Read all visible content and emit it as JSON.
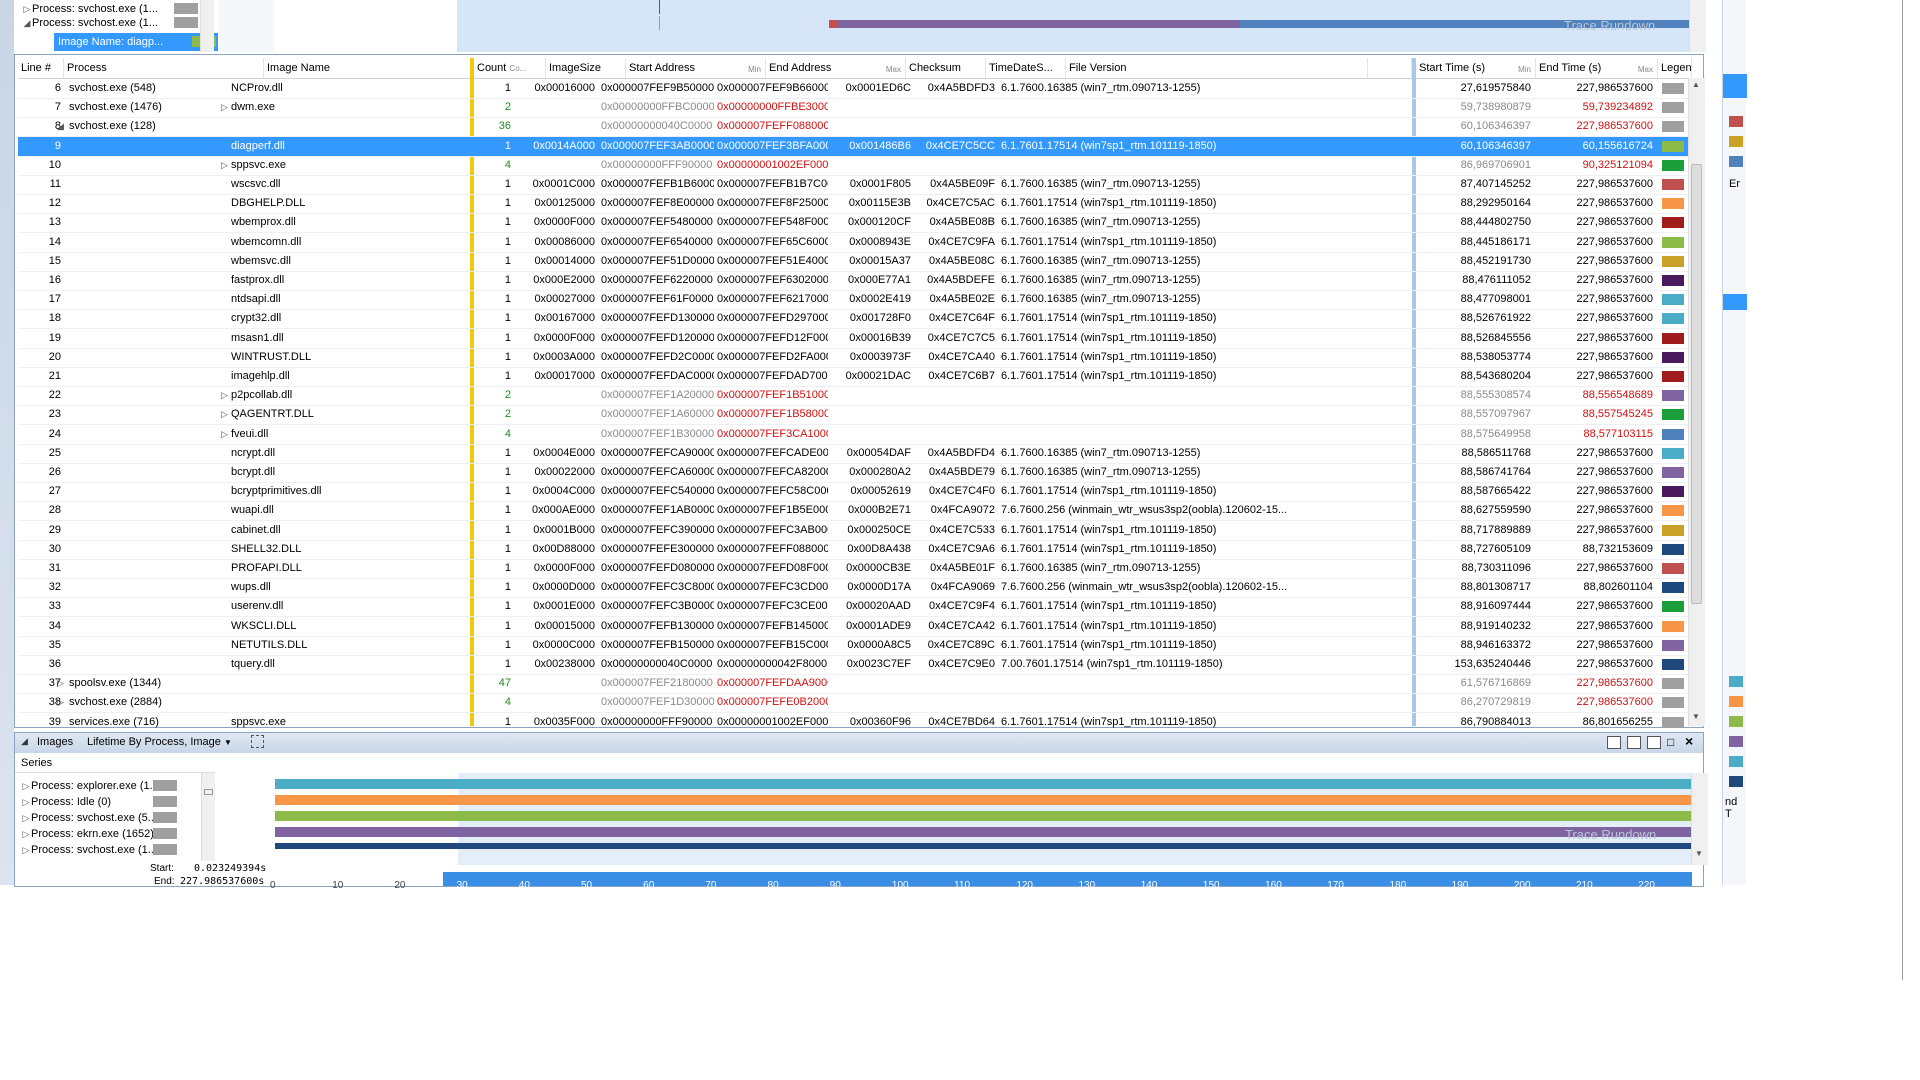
{
  "top_series": [
    {
      "label": "Process: svchost.exe (1...",
      "expanded": false,
      "color": "#a0a0a0"
    },
    {
      "label": "Process: svchost.exe (1...",
      "expanded": true,
      "color": "#a0a0a0"
    },
    {
      "label": "Image Name: diagp...",
      "selected": true,
      "color": "#8dbb4a"
    }
  ],
  "columns": {
    "line": "Line #",
    "process": "Process",
    "image_name": "Image Name",
    "count": "Count",
    "count_sub": "Co...",
    "image_size": "ImageSize",
    "start_address": "Start Address",
    "start_sub": "Min",
    "end_address": "End Address",
    "end_sub": "Max",
    "checksum": "Checksum",
    "timedate": "TimeDateS...",
    "file_version": "File Version",
    "start_time": "Start Time (s)",
    "start_time_sub": "Min",
    "end_time": "End Time (s)",
    "end_time_sub": "Max",
    "legend": "Legend"
  },
  "rows": [
    {
      "line": "6",
      "proc": "svchost.exe (548)",
      "proc_tri": "",
      "img": "NCProv.dll",
      "img_tri": "",
      "count": "1",
      "cc": "",
      "size": "0x00016000",
      "sa": "0x000007FEF9B50000",
      "ea": "0x000007FEF9B66000",
      "ec": "",
      "cs": "0x0001ED6C",
      "td": "0x4A5BDFD3",
      "fv": "6.1.7600.16385 (win7_rtm.090713-1255)",
      "st": "27,619575840",
      "stc": "",
      "et": "227,986537600",
      "etc": "",
      "lg": "#a0a0a0"
    },
    {
      "line": "7",
      "proc": "svchost.exe (1476)",
      "proc_tri": "",
      "img": "dwm.exe",
      "img_tri": "▷",
      "count": "2",
      "cc": "green",
      "size": "",
      "sa": "0x00000000FFBC0000",
      "ea": "0x00000000FFBE3000",
      "ec": "red",
      "cs": "",
      "td": "",
      "fv": "",
      "st": "59,738980879",
      "stc": "gray",
      "et": "59,739234892",
      "etc": "red",
      "lg": "#a0a0a0"
    },
    {
      "line": "8",
      "proc": "svchost.exe (128)",
      "proc_tri": "◢",
      "img": "",
      "img_tri": "",
      "count": "36",
      "cc": "green",
      "size": "",
      "sa": "0x00000000040C0000",
      "ea": "0x000007FEFF088000",
      "ec": "red",
      "cs": "",
      "td": "",
      "fv": "",
      "st": "60,106346397",
      "stc": "gray",
      "et": "227,986537600",
      "etc": "red",
      "lg": "#a0a0a0"
    },
    {
      "line": "9",
      "proc": "",
      "proc_tri": "",
      "img": "diagperf.dll",
      "img_tri": "",
      "count": "1",
      "cc": "",
      "size": "0x0014A000",
      "sa": "0x000007FEF3AB0000",
      "ea": "0x000007FEF3BFA000",
      "ec": "",
      "cs": "0x001486B6",
      "td": "0x4CE7C5CC",
      "fv": "6.1.7601.17514 (win7sp1_rtm.101119-1850)",
      "st": "60,106346397",
      "stc": "",
      "et": "60,155616724",
      "etc": "",
      "lg": "#8dbb4a",
      "sel": true
    },
    {
      "line": "10",
      "proc": "",
      "proc_tri": "",
      "img": "sppsvc.exe",
      "img_tri": "▷",
      "count": "4",
      "cc": "green",
      "size": "",
      "sa": "0x00000000FFF90000",
      "ea": "0x00000001002EF000",
      "ec": "red",
      "cs": "",
      "td": "",
      "fv": "",
      "st": "86,969706901",
      "stc": "gray",
      "et": "90,325121094",
      "etc": "red",
      "lg": "#1a9e3a"
    },
    {
      "line": "11",
      "proc": "",
      "proc_tri": "",
      "img": "wscsvc.dll",
      "img_tri": "",
      "count": "1",
      "cc": "",
      "size": "0x0001C000",
      "sa": "0x000007FEFB1B60000",
      "ea": "0x000007FEFB1B7C000",
      "ec": "",
      "cs": "0x0001F805",
      "td": "0x4A5BE09F",
      "fv": "6.1.7600.16385 (win7_rtm.090713-1255)",
      "st": "87,407145252",
      "stc": "",
      "et": "227,986537600",
      "etc": "",
      "lg": "#c0504d"
    },
    {
      "line": "12",
      "proc": "",
      "proc_tri": "",
      "img": "DBGHELP.DLL",
      "img_tri": "",
      "count": "1",
      "cc": "",
      "size": "0x00125000",
      "sa": "0x000007FEF8E00000",
      "ea": "0x000007FEF8F25000",
      "ec": "",
      "cs": "0x00115E3B",
      "td": "0x4CE7C5AC",
      "fv": "6.1.7601.17514 (win7sp1_rtm.101119-1850)",
      "st": "88,292950164",
      "stc": "",
      "et": "227,986537600",
      "etc": "",
      "lg": "#f79646"
    },
    {
      "line": "13",
      "proc": "",
      "proc_tri": "",
      "img": "wbemprox.dll",
      "img_tri": "",
      "count": "1",
      "cc": "",
      "size": "0x0000F000",
      "sa": "0x000007FEF5480000",
      "ea": "0x000007FEF548F000",
      "ec": "",
      "cs": "0x000120CF",
      "td": "0x4A5BE08B",
      "fv": "6.1.7600.16385 (win7_rtm.090713-1255)",
      "st": "88,444802750",
      "stc": "",
      "et": "227,986537600",
      "etc": "",
      "lg": "#a01c1c"
    },
    {
      "line": "14",
      "proc": "",
      "proc_tri": "",
      "img": "wbemcomn.dll",
      "img_tri": "",
      "count": "1",
      "cc": "",
      "size": "0x00086000",
      "sa": "0x000007FEF6540000",
      "ea": "0x000007FEF65C6000",
      "ec": "",
      "cs": "0x0008943E",
      "td": "0x4CE7C9FA",
      "fv": "6.1.7601.17514 (win7sp1_rtm.101119-1850)",
      "st": "88,445186171",
      "stc": "",
      "et": "227,986537600",
      "etc": "",
      "lg": "#8dbb4a"
    },
    {
      "line": "15",
      "proc": "",
      "proc_tri": "",
      "img": "wbemsvc.dll",
      "img_tri": "",
      "count": "1",
      "cc": "",
      "size": "0x00014000",
      "sa": "0x000007FEF51D0000",
      "ea": "0x000007FEF51E4000",
      "ec": "",
      "cs": "0x00015A37",
      "td": "0x4A5BE08C",
      "fv": "6.1.7600.16385 (win7_rtm.090713-1255)",
      "st": "88,452191730",
      "stc": "",
      "et": "227,986537600",
      "etc": "",
      "lg": "#c9a227"
    },
    {
      "line": "16",
      "proc": "",
      "proc_tri": "",
      "img": "fastprox.dll",
      "img_tri": "",
      "count": "1",
      "cc": "",
      "size": "0x000E2000",
      "sa": "0x000007FEF6220000",
      "ea": "0x000007FEF6302000",
      "ec": "",
      "cs": "0x000E77A1",
      "td": "0x4A5BDEFE",
      "fv": "6.1.7600.16385 (win7_rtm.090713-1255)",
      "st": "88,476111052",
      "stc": "",
      "et": "227,986537600",
      "etc": "",
      "lg": "#4b1a5e"
    },
    {
      "line": "17",
      "proc": "",
      "proc_tri": "",
      "img": "ntdsapi.dll",
      "img_tri": "",
      "count": "1",
      "cc": "",
      "size": "0x00027000",
      "sa": "0x000007FEF61F0000",
      "ea": "0x000007FEF6217000",
      "ec": "",
      "cs": "0x0002E419",
      "td": "0x4A5BE02E",
      "fv": "6.1.7600.16385 (win7_rtm.090713-1255)",
      "st": "88,477098001",
      "stc": "",
      "et": "227,986537600",
      "etc": "",
      "lg": "#4bacc6"
    },
    {
      "line": "18",
      "proc": "",
      "proc_tri": "",
      "img": "crypt32.dll",
      "img_tri": "",
      "count": "1",
      "cc": "",
      "size": "0x00167000",
      "sa": "0x000007FEFD130000",
      "ea": "0x000007FEFD297000",
      "ec": "",
      "cs": "0x001728F0",
      "td": "0x4CE7C64F",
      "fv": "6.1.7601.17514 (win7sp1_rtm.101119-1850)",
      "st": "88,526761922",
      "stc": "",
      "et": "227,986537600",
      "etc": "",
      "lg": "#4bacc6"
    },
    {
      "line": "19",
      "proc": "",
      "proc_tri": "",
      "img": "msasn1.dll",
      "img_tri": "",
      "count": "1",
      "cc": "",
      "size": "0x0000F000",
      "sa": "0x000007FEFD120000",
      "ea": "0x000007FEFD12F000",
      "ec": "",
      "cs": "0x00016B39",
      "td": "0x4CE7C7C5",
      "fv": "6.1.7601.17514 (win7sp1_rtm.101119-1850)",
      "st": "88,526845556",
      "stc": "",
      "et": "227,986537600",
      "etc": "",
      "lg": "#a01c1c"
    },
    {
      "line": "20",
      "proc": "",
      "proc_tri": "",
      "img": "WINTRUST.DLL",
      "img_tri": "",
      "count": "1",
      "cc": "",
      "size": "0x0003A000",
      "sa": "0x000007FEFD2C0000",
      "ea": "0x000007FEFD2FA000",
      "ec": "",
      "cs": "0x0003973F",
      "td": "0x4CE7CA40",
      "fv": "6.1.7601.17514 (win7sp1_rtm.101119-1850)",
      "st": "88,538053774",
      "stc": "",
      "et": "227,986537600",
      "etc": "",
      "lg": "#4b1a5e"
    },
    {
      "line": "21",
      "proc": "",
      "proc_tri": "",
      "img": "imagehlp.dll",
      "img_tri": "",
      "count": "1",
      "cc": "",
      "size": "0x00017000",
      "sa": "0x000007FEFDAC0000",
      "ea": "0x000007FEFDAD7000",
      "ec": "",
      "cs": "0x00021DAC",
      "td": "0x4CE7C6B7",
      "fv": "6.1.7601.17514 (win7sp1_rtm.101119-1850)",
      "st": "88,543680204",
      "stc": "",
      "et": "227,986537600",
      "etc": "",
      "lg": "#a01c1c"
    },
    {
      "line": "22",
      "proc": "",
      "proc_tri": "",
      "img": "p2pcollab.dll",
      "img_tri": "▷",
      "count": "2",
      "cc": "green",
      "size": "",
      "sa": "0x000007FEF1A20000",
      "ea": "0x000007FEF1B51000",
      "ec": "red",
      "cs": "",
      "td": "",
      "fv": "",
      "st": "88,555308574",
      "stc": "gray",
      "et": "88,556548689",
      "etc": "red",
      "lg": "#8064a2"
    },
    {
      "line": "23",
      "proc": "",
      "proc_tri": "",
      "img": "QAGENTRT.DLL",
      "img_tri": "▷",
      "count": "2",
      "cc": "green",
      "size": "",
      "sa": "0x000007FEF1A60000",
      "ea": "0x000007FEF1B58000",
      "ec": "red",
      "cs": "",
      "td": "",
      "fv": "",
      "st": "88,557097967",
      "stc": "gray",
      "et": "88,557545245",
      "etc": "red",
      "lg": "#1a9e3a"
    },
    {
      "line": "24",
      "proc": "",
      "proc_tri": "",
      "img": "fveui.dll",
      "img_tri": "▷",
      "count": "4",
      "cc": "green",
      "size": "",
      "sa": "0x000007FEF1B30000",
      "ea": "0x000007FEF3CA1000",
      "ec": "red",
      "cs": "",
      "td": "",
      "fv": "",
      "st": "88,575649958",
      "stc": "gray",
      "et": "88,577103115",
      "etc": "red",
      "lg": "#4f81bd"
    },
    {
      "line": "25",
      "proc": "",
      "proc_tri": "",
      "img": "ncrypt.dll",
      "img_tri": "",
      "count": "1",
      "cc": "",
      "size": "0x0004E000",
      "sa": "0x000007FEFCA90000",
      "ea": "0x000007FEFCADE000",
      "ec": "",
      "cs": "0x00054DAF",
      "td": "0x4A5BDFD4",
      "fv": "6.1.7600.16385 (win7_rtm.090713-1255)",
      "st": "88,586511768",
      "stc": "",
      "et": "227,986537600",
      "etc": "",
      "lg": "#4bacc6"
    },
    {
      "line": "26",
      "proc": "",
      "proc_tri": "",
      "img": "bcrypt.dll",
      "img_tri": "",
      "count": "1",
      "cc": "",
      "size": "0x00022000",
      "sa": "0x000007FEFCA60000",
      "ea": "0x000007FEFCA82000",
      "ec": "",
      "cs": "0x000280A2",
      "td": "0x4A5BDE79",
      "fv": "6.1.7600.16385 (win7_rtm.090713-1255)",
      "st": "88,586741764",
      "stc": "",
      "et": "227,986537600",
      "etc": "",
      "lg": "#8064a2"
    },
    {
      "line": "27",
      "proc": "",
      "proc_tri": "",
      "img": "bcryptprimitives.dll",
      "img_tri": "",
      "count": "1",
      "cc": "",
      "size": "0x0004C000",
      "sa": "0x000007FEFC540000",
      "ea": "0x000007FEFC58C000",
      "ec": "",
      "cs": "0x00052619",
      "td": "0x4CE7C4F0",
      "fv": "6.1.7601.17514 (win7sp1_rtm.101119-1850)",
      "st": "88,587665422",
      "stc": "",
      "et": "227,986537600",
      "etc": "",
      "lg": "#4b1a5e"
    },
    {
      "line": "28",
      "proc": "",
      "proc_tri": "",
      "img": "wuapi.dll",
      "img_tri": "",
      "count": "1",
      "cc": "",
      "size": "0x000AE000",
      "sa": "0x000007FEF1AB0000",
      "ea": "0x000007FEF1B5E000",
      "ec": "",
      "cs": "0x000B2E71",
      "td": "0x4FCA9072",
      "fv": "7.6.7600.256 (winmain_wtr_wsus3sp2(oobla).120602-15...",
      "st": "88,627559590",
      "stc": "",
      "et": "227,986537600",
      "etc": "",
      "lg": "#f79646"
    },
    {
      "line": "29",
      "proc": "",
      "proc_tri": "",
      "img": "cabinet.dll",
      "img_tri": "",
      "count": "1",
      "cc": "",
      "size": "0x0001B000",
      "sa": "0x000007FEFC390000",
      "ea": "0x000007FEFC3AB000",
      "ec": "",
      "cs": "0x000250CE",
      "td": "0x4CE7C533",
      "fv": "6.1.7601.17514 (win7sp1_rtm.101119-1850)",
      "st": "88,717889889",
      "stc": "",
      "et": "227,986537600",
      "etc": "",
      "lg": "#c9a227"
    },
    {
      "line": "30",
      "proc": "",
      "proc_tri": "",
      "img": "SHELL32.DLL",
      "img_tri": "",
      "count": "1",
      "cc": "",
      "size": "0x00D88000",
      "sa": "0x000007FEFE300000",
      "ea": "0x000007FEFF088000",
      "ec": "",
      "cs": "0x00D8A438",
      "td": "0x4CE7C9A6",
      "fv": "6.1.7601.17514 (win7sp1_rtm.101119-1850)",
      "st": "88,727605109",
      "stc": "",
      "et": "88,732153609",
      "etc": "",
      "lg": "#1f497d"
    },
    {
      "line": "31",
      "proc": "",
      "proc_tri": "",
      "img": "PROFAPI.DLL",
      "img_tri": "",
      "count": "1",
      "cc": "",
      "size": "0x0000F000",
      "sa": "0x000007FEFD080000",
      "ea": "0x000007FEFD08F000",
      "ec": "",
      "cs": "0x0000CB3E",
      "td": "0x4A5BE01F",
      "fv": "6.1.7600.16385 (win7_rtm.090713-1255)",
      "st": "88,730311096",
      "stc": "",
      "et": "227,986537600",
      "etc": "",
      "lg": "#c0504d"
    },
    {
      "line": "32",
      "proc": "",
      "proc_tri": "",
      "img": "wups.dll",
      "img_tri": "",
      "count": "1",
      "cc": "",
      "size": "0x0000D000",
      "sa": "0x000007FEFC3C8000",
      "ea": "0x000007FEFC3CD000",
      "ec": "",
      "cs": "0x0000D17A",
      "td": "0x4FCA9069",
      "fv": "7.6.7600.256 (winmain_wtr_wsus3sp2(oobla).120602-15...",
      "st": "88,801308717",
      "stc": "",
      "et": "88,802601104",
      "etc": "",
      "lg": "#1f497d"
    },
    {
      "line": "33",
      "proc": "",
      "proc_tri": "",
      "img": "userenv.dll",
      "img_tri": "",
      "count": "1",
      "cc": "",
      "size": "0x0001E000",
      "sa": "0x000007FEFC3B0000",
      "ea": "0x000007FEFC3CE000",
      "ec": "",
      "cs": "0x00020AAD",
      "td": "0x4CE7C9F4",
      "fv": "6.1.7601.17514 (win7sp1_rtm.101119-1850)",
      "st": "88,916097444",
      "stc": "",
      "et": "227,986537600",
      "etc": "",
      "lg": "#1a9e3a"
    },
    {
      "line": "34",
      "proc": "",
      "proc_tri": "",
      "img": "WKSCLI.DLL",
      "img_tri": "",
      "count": "1",
      "cc": "",
      "size": "0x00015000",
      "sa": "0x000007FEFB130000",
      "ea": "0x000007FEFB145000",
      "ec": "",
      "cs": "0x0001ADE9",
      "td": "0x4CE7CA42",
      "fv": "6.1.7601.17514 (win7sp1_rtm.101119-1850)",
      "st": "88,919140232",
      "stc": "",
      "et": "227,986537600",
      "etc": "",
      "lg": "#f79646"
    },
    {
      "line": "35",
      "proc": "",
      "proc_tri": "",
      "img": "NETUTILS.DLL",
      "img_tri": "",
      "count": "1",
      "cc": "",
      "size": "0x0000C000",
      "sa": "0x000007FEFB150000",
      "ea": "0x000007FEFB15C000",
      "ec": "",
      "cs": "0x0000A8C5",
      "td": "0x4CE7C89C",
      "fv": "6.1.7601.17514 (win7sp1_rtm.101119-1850)",
      "st": "88,946163372",
      "stc": "",
      "et": "227,986537600",
      "etc": "",
      "lg": "#8064a2"
    },
    {
      "line": "36",
      "proc": "",
      "proc_tri": "",
      "img": "tquery.dll",
      "img_tri": "",
      "count": "1",
      "cc": "",
      "size": "0x00238000",
      "sa": "0x00000000040C0000",
      "ea": "0x00000000042F8000",
      "ec": "",
      "cs": "0x0023C7EF",
      "td": "0x4CE7C9E0",
      "fv": "7.00.7601.17514 (win7sp1_rtm.101119-1850)",
      "st": "153,635240446",
      "stc": "",
      "et": "227,986537600",
      "etc": "",
      "lg": "#1f497d"
    },
    {
      "line": "37",
      "proc": "spoolsv.exe (1344)",
      "proc_tri": "▷",
      "img": "",
      "img_tri": "",
      "count": "47",
      "cc": "green",
      "size": "",
      "sa": "0x000007FEF2180000",
      "ea": "0x000007FEFDAA9000",
      "ec": "red",
      "cs": "",
      "td": "",
      "fv": "",
      "st": "61,576716869",
      "stc": "gray",
      "et": "227,986537600",
      "etc": "red",
      "lg": "#a0a0a0"
    },
    {
      "line": "38",
      "proc": "svchost.exe (2884)",
      "proc_tri": "▷",
      "img": "",
      "img_tri": "",
      "count": "4",
      "cc": "green",
      "size": "",
      "sa": "0x000007FEF1D30000",
      "ea": "0x000007FEFE0B2000",
      "ec": "red",
      "cs": "",
      "td": "",
      "fv": "",
      "st": "86,270729819",
      "stc": "gray",
      "et": "227,986537600",
      "etc": "red",
      "lg": "#a0a0a0"
    },
    {
      "line": "39",
      "proc": "services.exe (716)",
      "proc_tri": "",
      "img": "sppsvc.exe",
      "img_tri": "",
      "count": "1",
      "cc": "",
      "size": "0x0035F000",
      "sa": "0x00000000FFF90000",
      "ea": "0x00000001002EF000",
      "ec": "",
      "cs": "0x00360F96",
      "td": "0x4CE7BD64",
      "fv": "6.1.7601.17514 (win7sp1_rtm.101119-1850)",
      "st": "86,790884013",
      "stc": "",
      "et": "86,801656255",
      "etc": "",
      "lg": "#a0a0a0"
    }
  ],
  "bottom_panel": {
    "title": "Images",
    "preset": "Lifetime By Process, Image",
    "series_header": "Series",
    "series": [
      {
        "label": "Process: explorer.exe (1...",
        "color": "#4bacc6"
      },
      {
        "label": "Process: Idle (0)",
        "color": "#f79646"
      },
      {
        "label": "Process: svchost.exe (5...",
        "color": "#8dbb4a"
      },
      {
        "label": "Process: ekrn.exe (1652)",
        "color": "#8064a2"
      },
      {
        "label": "Process: svchost.exe (1...",
        "color": "#1f497d"
      }
    ],
    "start_label": "Start:",
    "start_value": "0.023249394s",
    "end_label": "End:",
    "end_value": "227.986537600s",
    "watermark": "Trace Rundown",
    "ticks": [
      "0",
      "10",
      "20",
      "30",
      "40",
      "50",
      "60",
      "70",
      "80",
      "90",
      "100",
      "110",
      "120",
      "130",
      "140",
      "150",
      "160",
      "170",
      "180",
      "190",
      "200",
      "210",
      "220"
    ]
  },
  "right_partial": {
    "er_label": "Er",
    "nd_label": "nd T"
  }
}
